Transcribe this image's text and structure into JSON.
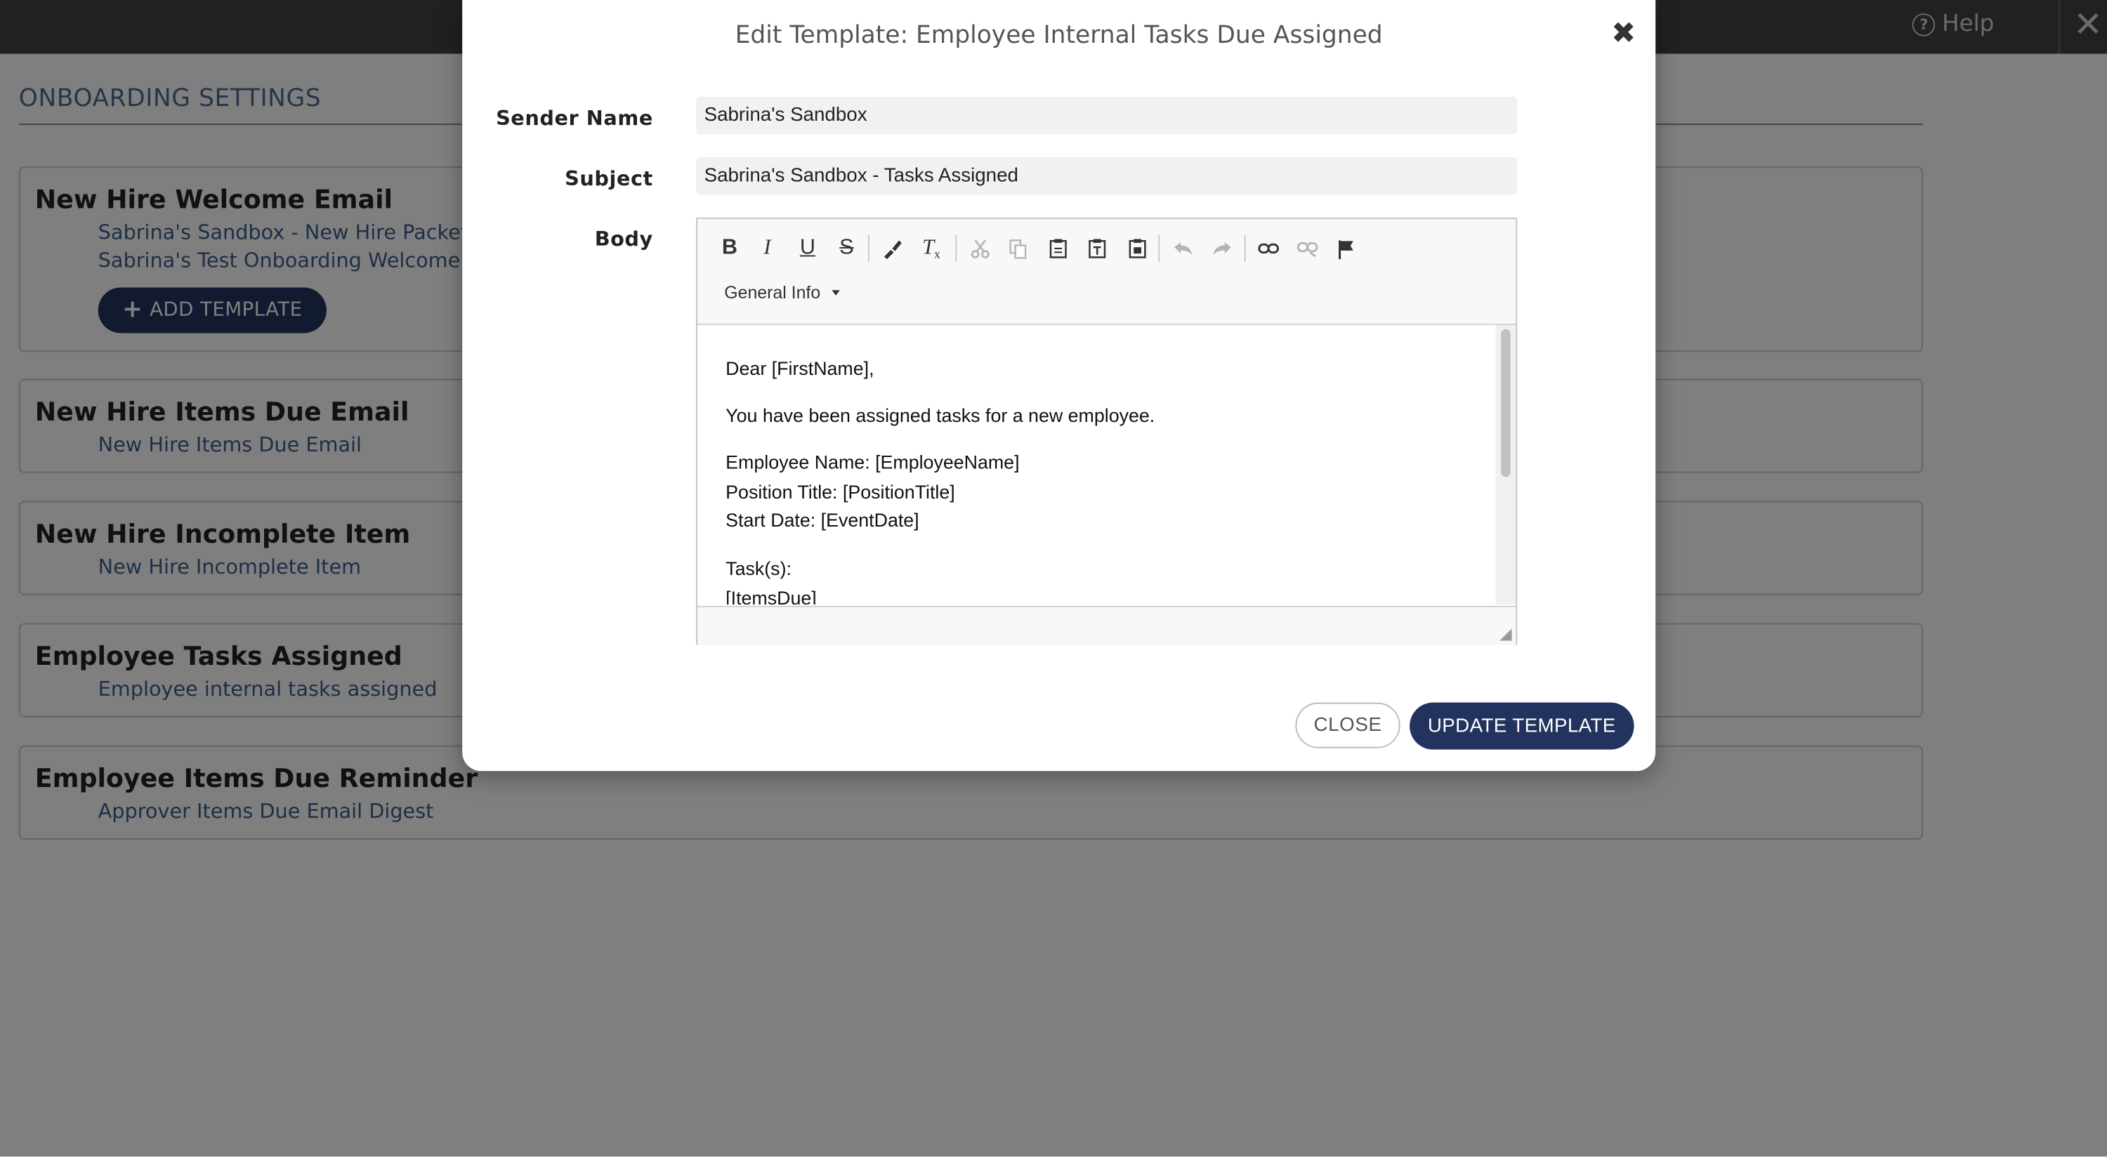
{
  "topbar": {
    "help_label": "Help",
    "close_glyph": "✕"
  },
  "page": {
    "title": "ONBOARDING SETTINGS",
    "cards": [
      {
        "title": "New Hire Welcome Email",
        "links": [
          "Sabrina's Sandbox - New Hire Packet",
          "Sabrina's Test Onboarding Welcome"
        ],
        "add_button": "ADD TEMPLATE"
      },
      {
        "title": "New Hire Items Due Email",
        "links": [
          "New Hire Items Due Email"
        ]
      },
      {
        "title": "New Hire Incomplete Item",
        "links": [
          "New Hire Incomplete Item"
        ]
      },
      {
        "title": "Employee Tasks Assigned",
        "links": [
          "Employee internal tasks assigned"
        ]
      },
      {
        "title": "Employee Items Due Reminder",
        "links": [
          "Approver Items Due Email Digest"
        ]
      }
    ]
  },
  "modal": {
    "title": "Edit Template: Employee Internal Tasks Due Assigned",
    "close_glyph": "✖",
    "sender_label": "Sender Name",
    "sender_value": "Sabrina's Sandbox",
    "subject_label": "Subject",
    "subject_value": "Sabrina's Sandbox - Tasks Assigned",
    "body_label": "Body",
    "editor": {
      "toolbar_icons": [
        "bold-icon",
        "italic-icon",
        "underline-icon",
        "strikethrough-icon",
        "copy-formatting-icon",
        "remove-format-icon",
        "cut-icon",
        "copy-icon",
        "paste-icon",
        "paste-text-icon",
        "paste-from-word-icon",
        "undo-icon",
        "redo-icon",
        "link-icon",
        "unlink-icon",
        "anchor-flag-icon"
      ],
      "placeholder_combo": "General Info",
      "body_lines": [
        "Dear [FirstName],",
        "You have been assigned tasks for a new employee.",
        "Employee Name: [EmployeeName]",
        "Position Title: [PositionTitle]",
        "Start Date: [EventDate]",
        "Task(s):",
        "[ItemsDue]"
      ]
    },
    "close_button": "CLOSE",
    "update_button": "UPDATE TEMPLATE"
  }
}
